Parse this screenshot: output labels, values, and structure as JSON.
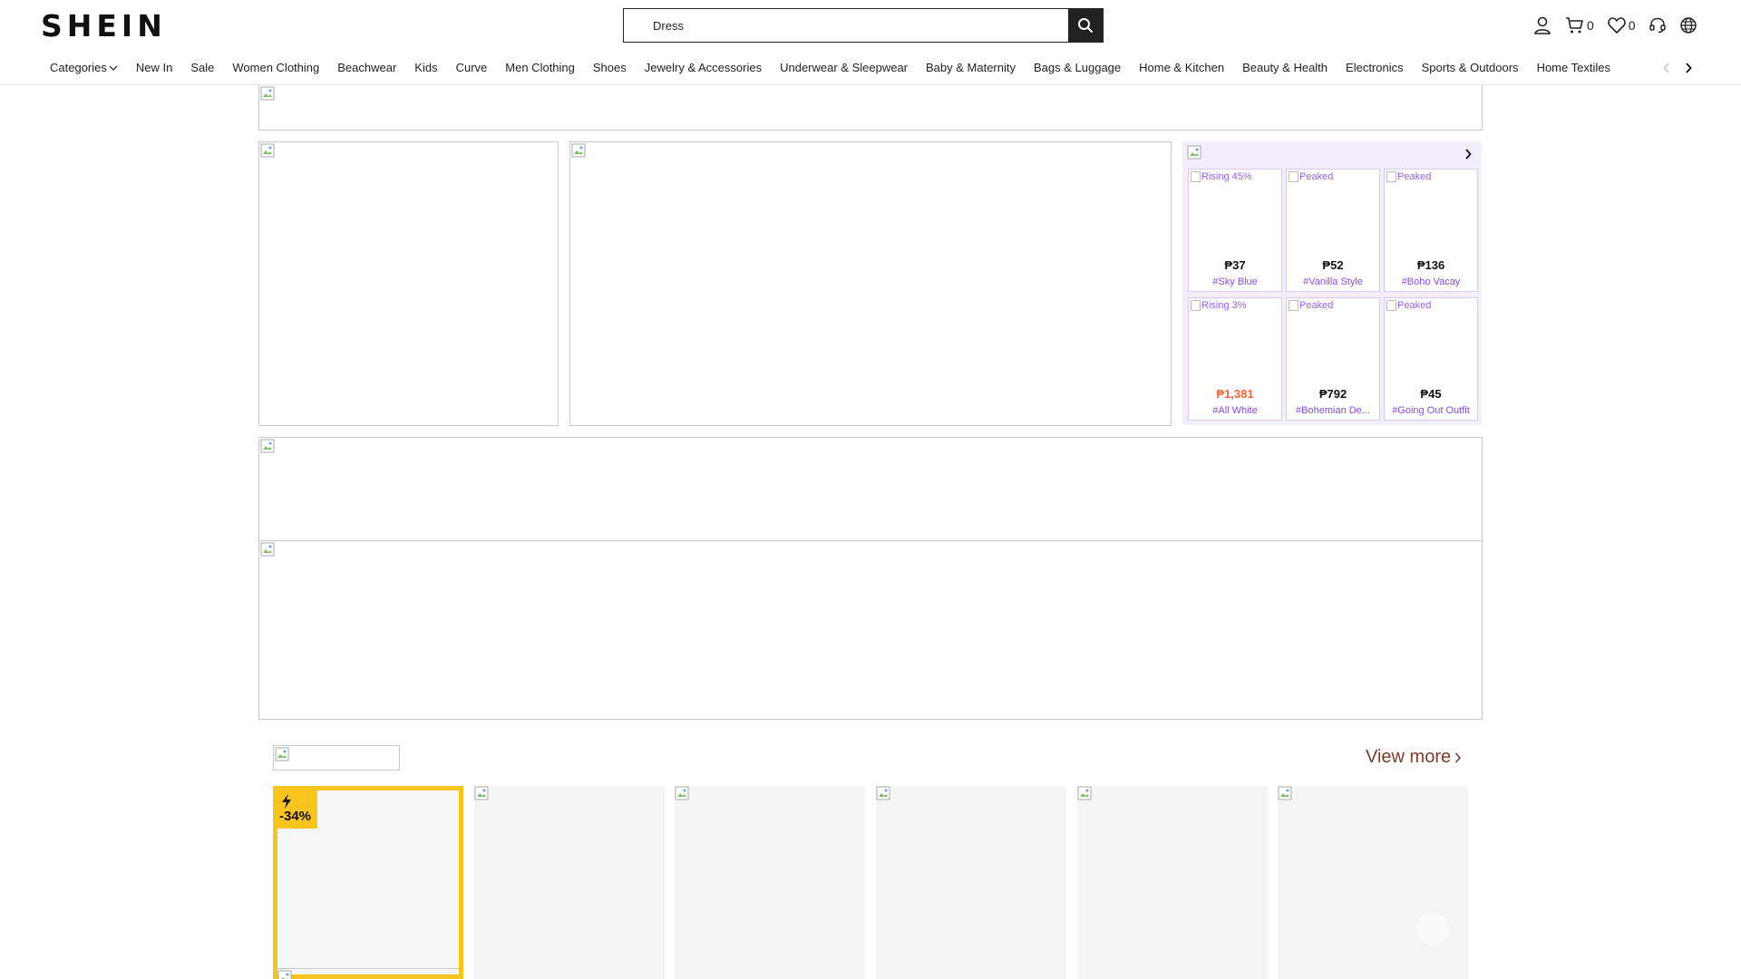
{
  "header": {
    "logo": "SHEIN",
    "search": {
      "value": "Dress",
      "placeholder": ""
    },
    "cart_count": "0",
    "wishlist_count": "0"
  },
  "nav": {
    "items": [
      "Categories",
      "New In",
      "Sale",
      "Women Clothing",
      "Beachwear",
      "Kids",
      "Curve",
      "Men Clothing",
      "Shoes",
      "Jewelry & Accessories",
      "Underwear & Sleepwear",
      "Baby & Maternity",
      "Bags & Luggage",
      "Home & Kitchen",
      "Beauty & Health",
      "Electronics",
      "Sports & Outdoors",
      "Home Textiles"
    ]
  },
  "trends": {
    "cards": [
      {
        "tag": "Rising 45%",
        "price": "₱37",
        "name": "#Sky Blue",
        "price_highlight": false
      },
      {
        "tag": "Peaked",
        "price": "₱52",
        "name": "#Vanilla Style",
        "price_highlight": false
      },
      {
        "tag": "Peaked",
        "price": "₱136",
        "name": "#Boho Vacay",
        "price_highlight": false
      },
      {
        "tag": "Rising 3%",
        "price": "₱1,381",
        "name": "#All White",
        "price_highlight": true
      },
      {
        "tag": "Peaked",
        "price": "₱792",
        "name": "#Bohemian De...",
        "price_highlight": false
      },
      {
        "tag": "Peaked",
        "price": "₱45",
        "name": "#Going Out Outfit",
        "price_highlight": false
      }
    ]
  },
  "flash_sale": {
    "view_more": "View more",
    "featured_discount": "-34%"
  },
  "colors": {
    "accent_yellow": "#f8c41d",
    "trend_purple": "#9b5cf0",
    "price_highlight": "#fa6338",
    "view_more": "#7a3b2e"
  }
}
